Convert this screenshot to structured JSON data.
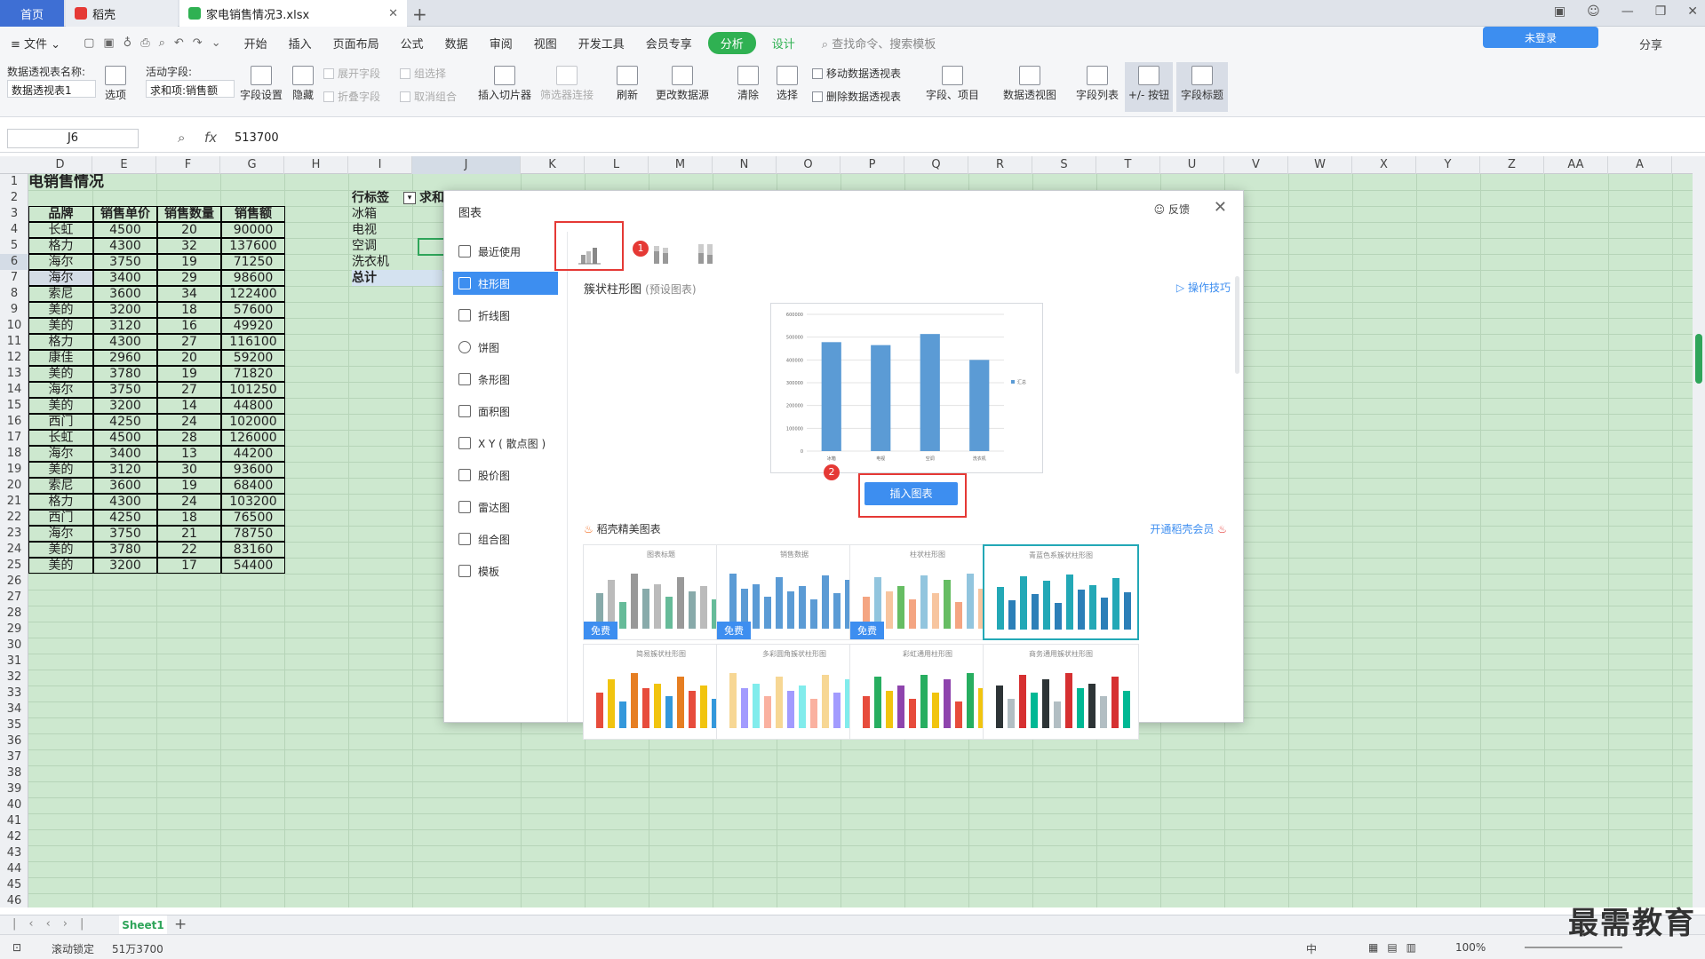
{
  "tabs": {
    "home": "首页",
    "wps": "稻壳",
    "file": "家电销售情况3.xlsx"
  },
  "menu": {
    "file": "文件",
    "items": [
      "开始",
      "插入",
      "页面布局",
      "公式",
      "数据",
      "审阅",
      "视图",
      "开发工具",
      "会员专享"
    ],
    "active": "分析",
    "design": "设计",
    "search": "查找命令、搜索模板",
    "login": "未登录",
    "share": "分享"
  },
  "ribbon": {
    "pivot_name_label": "数据透视表名称:",
    "pivot_name_value": "数据透视表1",
    "options": "选项",
    "active_field_label": "活动字段:",
    "active_field_value": "求和项:销售额",
    "field_settings": "字段设置",
    "hide": "隐藏",
    "expand_field": "展开字段",
    "collapse_field": "折叠字段",
    "group_selection": "组选择",
    "ungroup": "取消组合",
    "insert_slicer": "插入切片器",
    "filter_connection": "筛选器连接",
    "refresh": "刷新",
    "change_source": "更改数据源",
    "clear": "清除",
    "select": "选择",
    "move_pivot": "移动数据透视表",
    "delete_pivot": "删除数据透视表",
    "fields_items": "字段、项目",
    "pivot_chart": "数据透视图",
    "field_list": "字段列表",
    "plus_minus": "+/- 按钮",
    "field_headers": "字段标题"
  },
  "formula_bar": {
    "name_box": "J6",
    "fx": "fx",
    "value": "513700"
  },
  "sheet": {
    "columns": [
      "D",
      "E",
      "F",
      "G",
      "H",
      "I",
      "J",
      "K",
      "L",
      "M",
      "N",
      "O",
      "P",
      "Q",
      "R",
      "S",
      "T",
      "U",
      "V",
      "W",
      "X",
      "Y",
      "Z",
      "AA",
      "A"
    ],
    "rows": [
      "1",
      "2",
      "3",
      "4",
      "5",
      "6",
      "7",
      "8",
      "9",
      "10",
      "11",
      "12",
      "13",
      "14",
      "15",
      "16",
      "17",
      "18",
      "19",
      "20",
      "21",
      "22",
      "23",
      "24",
      "25",
      "26",
      "27",
      "28",
      "29",
      "30",
      "31",
      "32",
      "33",
      "34",
      "35",
      "36",
      "37",
      "38",
      "39",
      "40",
      "41",
      "42",
      "43",
      "44",
      "45",
      "46"
    ],
    "title": "电销售情况",
    "headers": [
      "品牌",
      "销售单价",
      "销售数量",
      "销售额"
    ],
    "data": [
      [
        "长虹",
        "4500",
        "20",
        "90000"
      ],
      [
        "格力",
        "4300",
        "32",
        "137600"
      ],
      [
        "海尔",
        "3750",
        "19",
        "71250"
      ],
      [
        "海尔",
        "3400",
        "29",
        "98600"
      ],
      [
        "索尼",
        "3600",
        "34",
        "122400"
      ],
      [
        "美的",
        "3200",
        "18",
        "57600"
      ],
      [
        "美的",
        "3120",
        "16",
        "49920"
      ],
      [
        "格力",
        "4300",
        "27",
        "116100"
      ],
      [
        "康佳",
        "2960",
        "20",
        "59200"
      ],
      [
        "美的",
        "3780",
        "19",
        "71820"
      ],
      [
        "海尔",
        "3750",
        "27",
        "101250"
      ],
      [
        "美的",
        "3200",
        "14",
        "44800"
      ],
      [
        "西门",
        "4250",
        "24",
        "102000"
      ],
      [
        "长虹",
        "4500",
        "28",
        "126000"
      ],
      [
        "海尔",
        "3400",
        "13",
        "44200"
      ],
      [
        "美的",
        "3120",
        "30",
        "93600"
      ],
      [
        "索尼",
        "3600",
        "19",
        "68400"
      ],
      [
        "格力",
        "4300",
        "24",
        "103200"
      ],
      [
        "西门",
        "4250",
        "18",
        "76500"
      ],
      [
        "海尔",
        "3750",
        "21",
        "78750"
      ],
      [
        "美的",
        "3780",
        "22",
        "83160"
      ],
      [
        "美的",
        "3200",
        "17",
        "54400"
      ]
    ],
    "pivot": {
      "row_label": "行标签",
      "sum_label": "求和",
      "items": [
        "冰箱",
        "电视",
        "空调",
        "洗衣机"
      ],
      "total": "总计"
    }
  },
  "dialog": {
    "title": "图表",
    "feedback": "反馈",
    "nav": [
      "最近使用",
      "柱形图",
      "折线图",
      "饼图",
      "条形图",
      "面积图",
      "X Y ( 散点图 )",
      "股价图",
      "雷达图",
      "组合图",
      "模板"
    ],
    "active_nav": "柱形图",
    "badge1": "1",
    "badge2": "2",
    "subtitle": "簇状柱形图",
    "subtitle_hint": "(预设图表)",
    "tips": "操作技巧",
    "insert_button": "插入图表",
    "premium_title": "稻壳精美图表",
    "vip_link": "开通稻壳会员",
    "free_label": "免费",
    "templates": [
      {
        "title": "图表标题",
        "free": true
      },
      {
        "title": "销售数据",
        "free": true
      },
      {
        "title": "柱状柱形图",
        "free": true
      },
      {
        "title": "青蓝色系簇状柱形图",
        "free": false
      },
      {
        "title": "简易簇状柱形图",
        "free": false
      },
      {
        "title": "多彩圆角簇状柱形图",
        "free": false
      },
      {
        "title": "彩虹通用柱形图",
        "free": false
      },
      {
        "title": "商务通用簇状柱形图",
        "free": false
      }
    ]
  },
  "chart_data": {
    "type": "bar",
    "categories": [
      "冰箱",
      "电视",
      "空调",
      "洗衣机"
    ],
    "values": [
      478000,
      465000,
      513700,
      400000
    ],
    "series": [
      {
        "name": "汇总",
        "values": [
          478000,
          465000,
          513700,
          400000
        ]
      }
    ],
    "ylim": [
      0,
      600000
    ],
    "yticks": [
      "0",
      "100000",
      "200000",
      "300000",
      "400000",
      "500000",
      "600000"
    ],
    "legend": "right",
    "color": "#5b9bd5"
  },
  "status": {
    "scroll_lock": "滚动锁定",
    "sum": "51万3700",
    "sheet_name": "Sheet1",
    "input_mode": "中",
    "zoom": "100%"
  },
  "watermark": "最需教育"
}
